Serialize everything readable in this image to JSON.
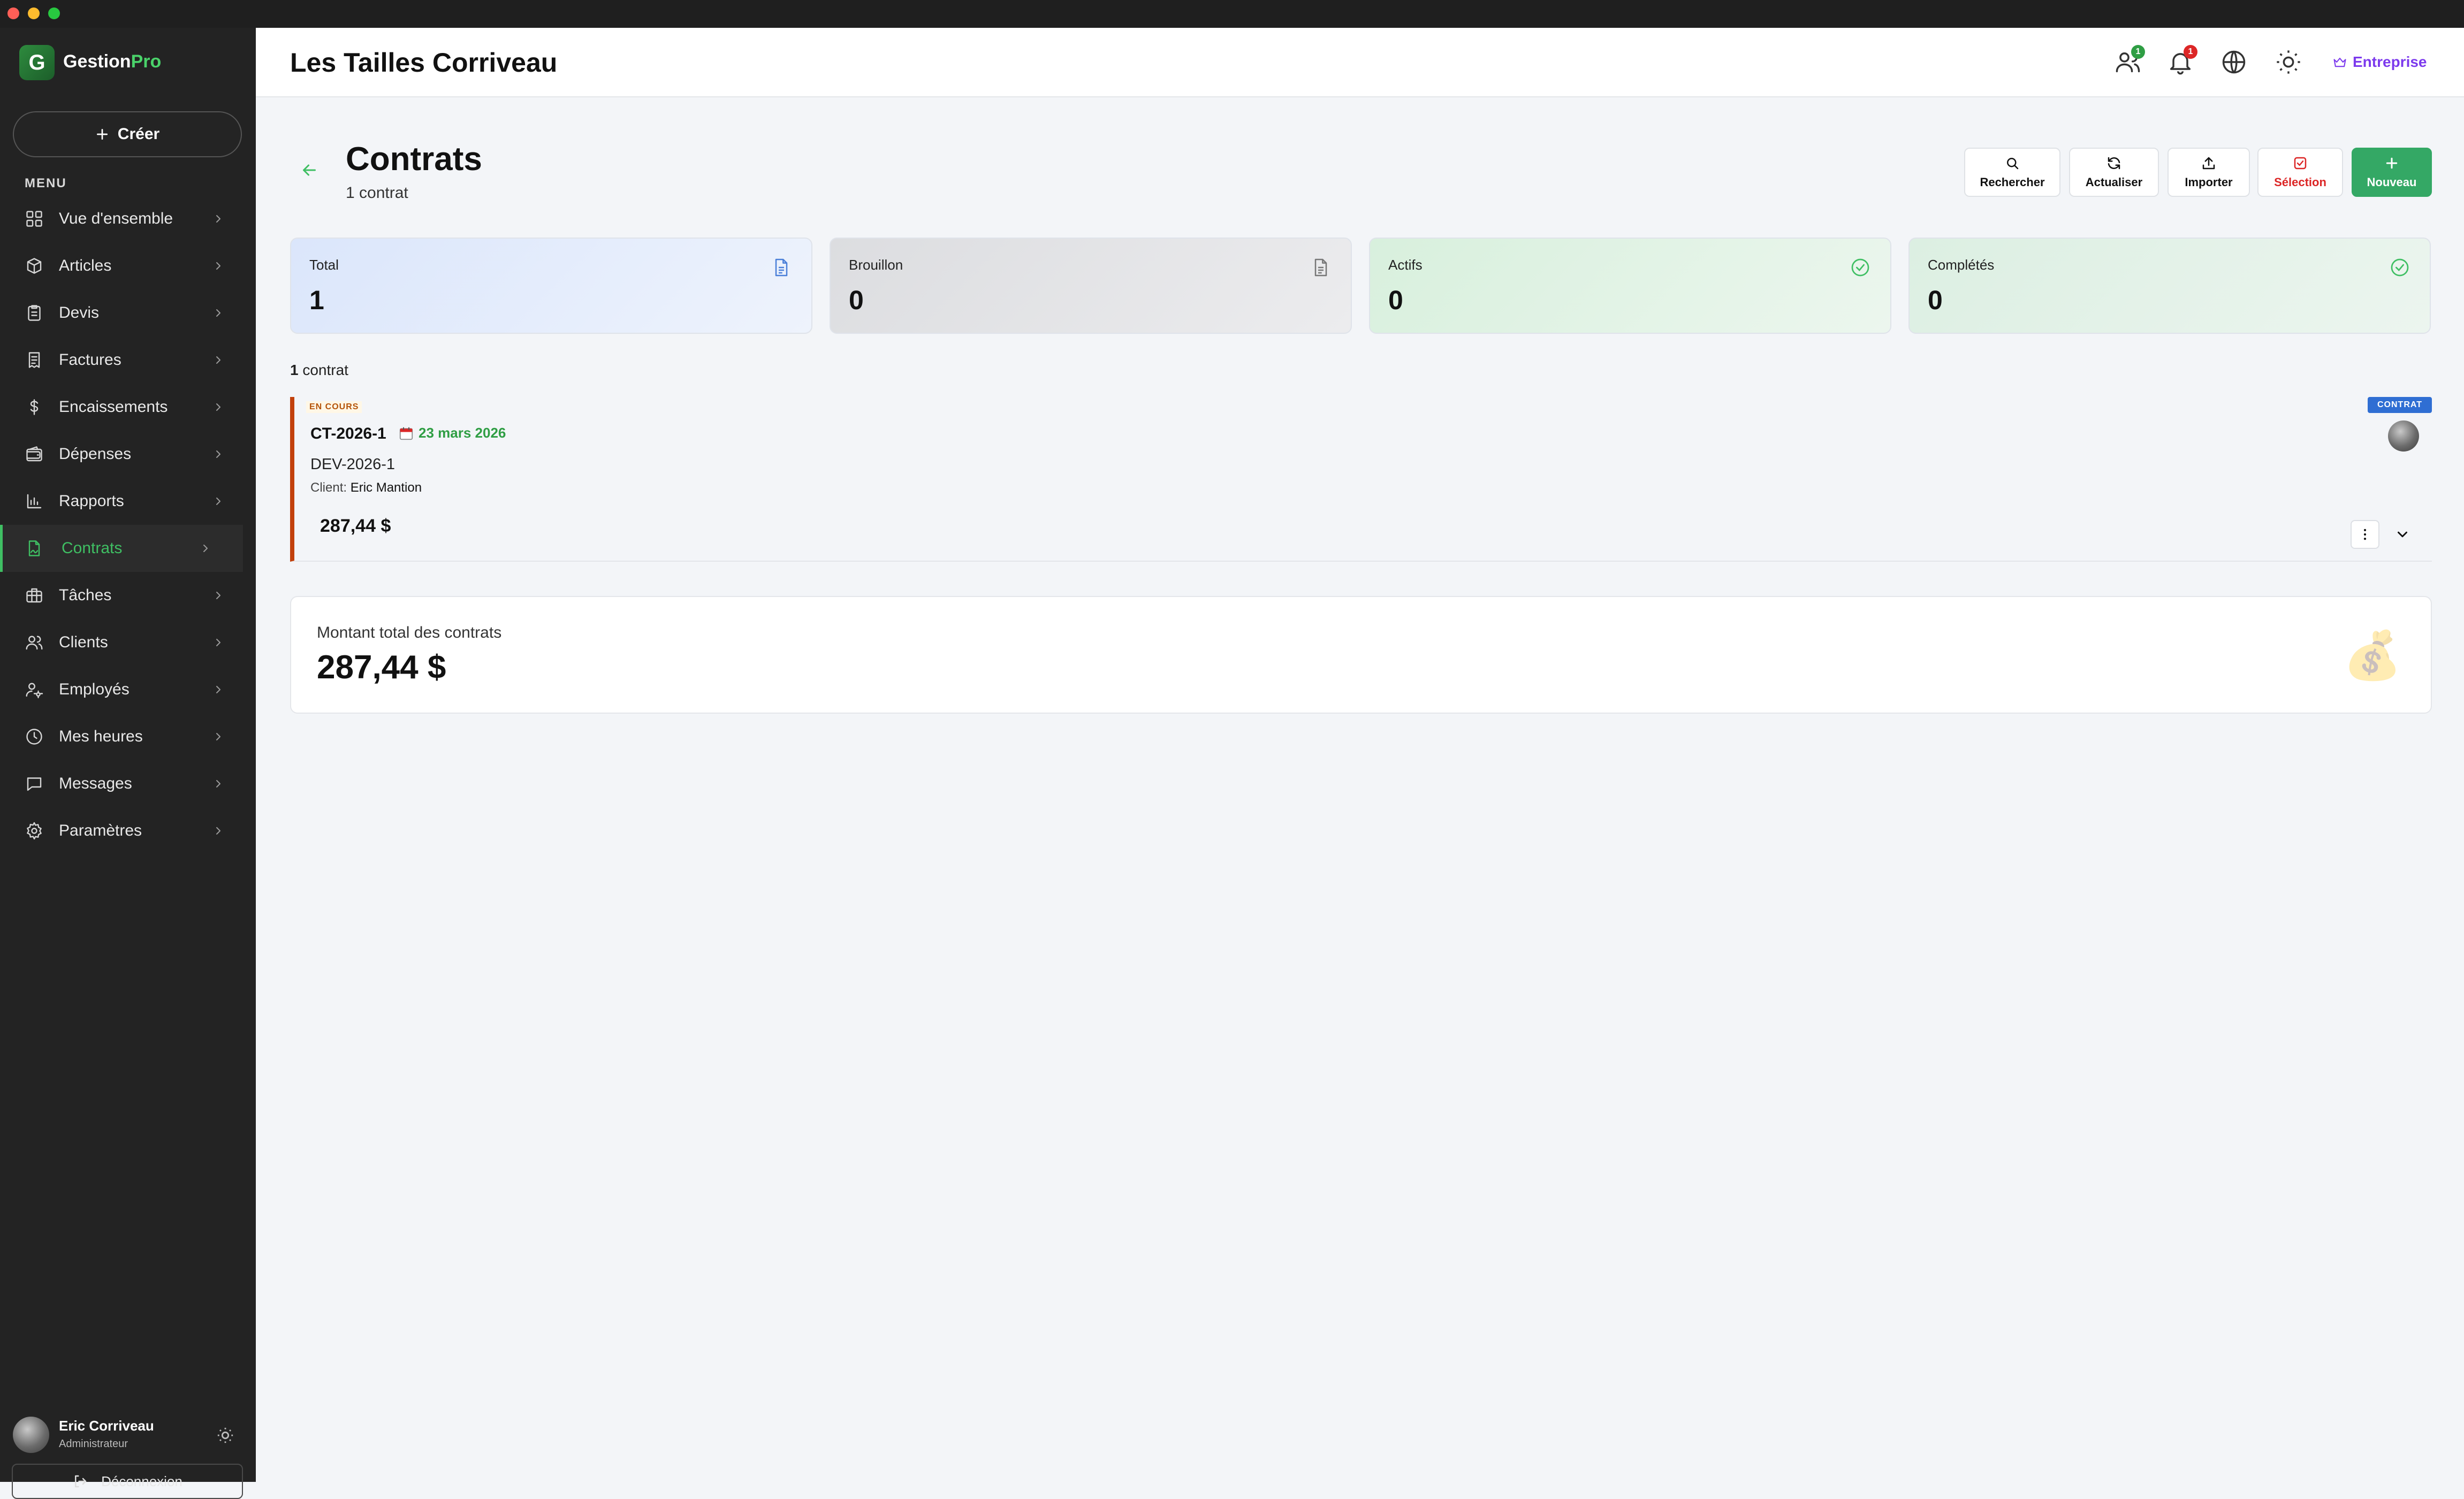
{
  "app": {
    "name_prefix": "Gestion",
    "name_suffix": "Pro",
    "logo_letter": "G"
  },
  "sidebar": {
    "create_label": "Créer",
    "menu_label": "MENU",
    "items": [
      {
        "label": "Vue d'ensemble",
        "icon": "grid-icon"
      },
      {
        "label": "Articles",
        "icon": "box-icon"
      },
      {
        "label": "Devis",
        "icon": "clipboard-icon"
      },
      {
        "label": "Factures",
        "icon": "receipt-icon"
      },
      {
        "label": "Encaissements",
        "icon": "dollar-icon"
      },
      {
        "label": "Dépenses",
        "icon": "wallet-icon"
      },
      {
        "label": "Rapports",
        "icon": "bar-chart-icon"
      },
      {
        "label": "Contrats",
        "icon": "contract-icon",
        "active": true
      },
      {
        "label": "Tâches",
        "icon": "briefcase-icon"
      },
      {
        "label": "Clients",
        "icon": "users-icon"
      },
      {
        "label": "Employés",
        "icon": "user-gear-icon"
      },
      {
        "label": "Mes heures",
        "icon": "clock-icon"
      },
      {
        "label": "Messages",
        "icon": "message-icon"
      },
      {
        "label": "Paramètres",
        "icon": "gear-icon"
      }
    ],
    "user": {
      "name": "Eric Corriveau",
      "role": "Administrateur"
    },
    "logout_label": "Déconnexion"
  },
  "header": {
    "company": "Les Tailles Corriveau",
    "users_badge": "1",
    "notif_badge": "1",
    "plan_label": "Entreprise"
  },
  "page": {
    "title": "Contrats",
    "subtitle": "1 contrat",
    "actions": {
      "search": "Rechercher",
      "refresh": "Actualiser",
      "import": "Importer",
      "select": "Sélection",
      "new": "Nouveau"
    }
  },
  "stats": [
    {
      "label": "Total",
      "value": "1"
    },
    {
      "label": "Brouillon",
      "value": "0"
    },
    {
      "label": "Actifs",
      "value": "0"
    },
    {
      "label": "Complétés",
      "value": "0"
    }
  ],
  "list": {
    "count_num": "1",
    "count_word": "contrat",
    "contract": {
      "status": "EN COURS",
      "number": "CT-2026-1",
      "date": "23 mars 2026",
      "quote": "DEV-2026-1",
      "client_label": "Client:",
      "client_name": "Eric Mantion",
      "amount": "287,44 $",
      "type_badge": "CONTRAT"
    }
  },
  "totals": {
    "label": "Montant total des contrats",
    "value": "287,44 $"
  },
  "colors": {
    "accent": "#3fbf63",
    "status": "#c2410c",
    "badge_blue": "#2f6ed3",
    "danger": "#dc2626"
  }
}
